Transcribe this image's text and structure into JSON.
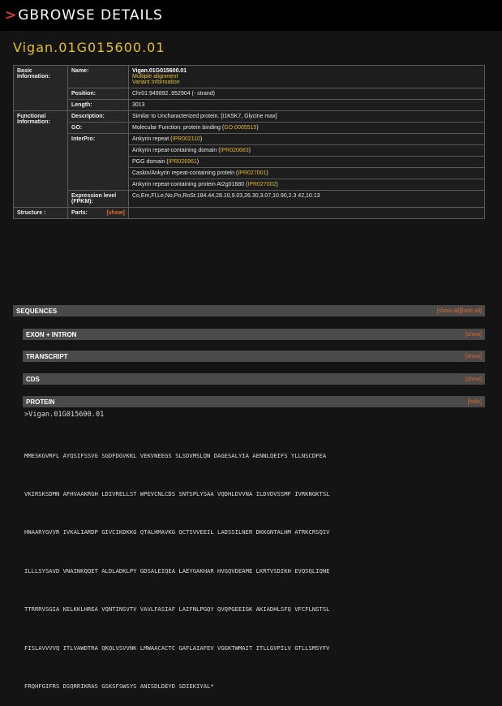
{
  "header": {
    "chevron": ">",
    "title": "GBROWSE DETAILS"
  },
  "gene_title": "Vigan.01G015600.01",
  "info": {
    "basic_label": "Basic Information:",
    "name_label": "Name:",
    "name_value": "Vigan.01G015600.01",
    "multiple_alignment": "Multiple alignment",
    "variant_information": "Variant Information",
    "position_label": "Position:",
    "position_value": "Chr01:949892..952904 (- strand)",
    "length_label": "Length:",
    "length_value": "3013",
    "functional_label": "Functional Information:",
    "description_label": "Description:",
    "description_value": "Similar to Uncharacterized protein. [I1K5K7, Glycine max]",
    "go_label": "GO:",
    "go_text": "Molecular Function: protein binding (",
    "go_link": "GO:0005515",
    "go_close": ")",
    "interpro_label": "InterPro:",
    "interpro": [
      {
        "text": "Ankyrin repeat (",
        "link": "IPR002110",
        "close": ")"
      },
      {
        "text": "Ankyrin repeat-containing domain (",
        "link": "IPR020683",
        "close": ")"
      },
      {
        "text": "PGG domain (",
        "link": "IPR026961",
        "close": ")"
      },
      {
        "text": "Caskin/Ankyrin repeat-containing protein (",
        "link": "IPR027001",
        "close": ")"
      },
      {
        "text": "Ankyrin repeat-containing protein At2g01680 (",
        "link": "IPR027002",
        "close": ")"
      }
    ],
    "expression_label": "Expression level (FPKM):",
    "expression_value": "Co,Em,Fl,Le,No,Po,RoSt:184.44,28.10,9.03,26.30,3.07,10.90,2.3 42,10.13",
    "structure_label": "Structure :",
    "parts_label": "Parts:",
    "parts_show": "[show]"
  },
  "sections": {
    "sequences": {
      "label": "SEQUENCES",
      "action": "[show all][hide all]"
    },
    "exon": {
      "label": "EXON + INTRON",
      "action": "[show]"
    },
    "transcript": {
      "label": "TRANSCRIPT",
      "action": "[show]"
    },
    "cds": {
      "label": "CDS",
      "action": "[show]"
    },
    "protein": {
      "label": "PROTEIN",
      "action": "[hide]"
    }
  },
  "protein": {
    "id": ">Vigan.01G015600.01",
    "lines": [
      "MMESKGVRFL AYQSIFSSVG SGDFDGVKKL VEKVNEEGS SLSDVMSLQN DAGESALYIA AENNLQEIFS YLLNSCDFEA",
      "VKIRSKSDMN AFHVAAKRGH LDIVRELLST WPEVCNLCDS SNTSPLYSAA VQDHLDVVNA ILDVDVSSMF IVRKNGKTSL",
      "HNAARYGVVR IVKALIARDP GIVCIKDKKG QTALHMAVKG QCTSVVEEIL LADSSILNER DKKGNTALHM ATRKCRSQIV",
      "ILLLSYSAVD VNAINKQQET ALDLADKLPY GDSALEIQEA LAEYGAKHAR HVGQVDEAME LKRTVSDIKH EVQSQLIQNE",
      "TTRRRVSGIA KELKKLHREA VQNTINSVTV VAVLFASIAF LAIFNLPGQY QVQPGEEIGK AKIADHLSFQ VFCFLNSTSL",
      "FISLAVVVVQ ITLVAWDTRA QKQLVSVVNK LMWAACACTC GAFLAIAFEV VGGKTWMAIT ITLLGVPILV GTLLSMSYFV",
      "FRQHFGIFRS DSQRRIKRAS GSKSFSWSYS ANISDLDEYD SDIEKIYAL*"
    ]
  }
}
